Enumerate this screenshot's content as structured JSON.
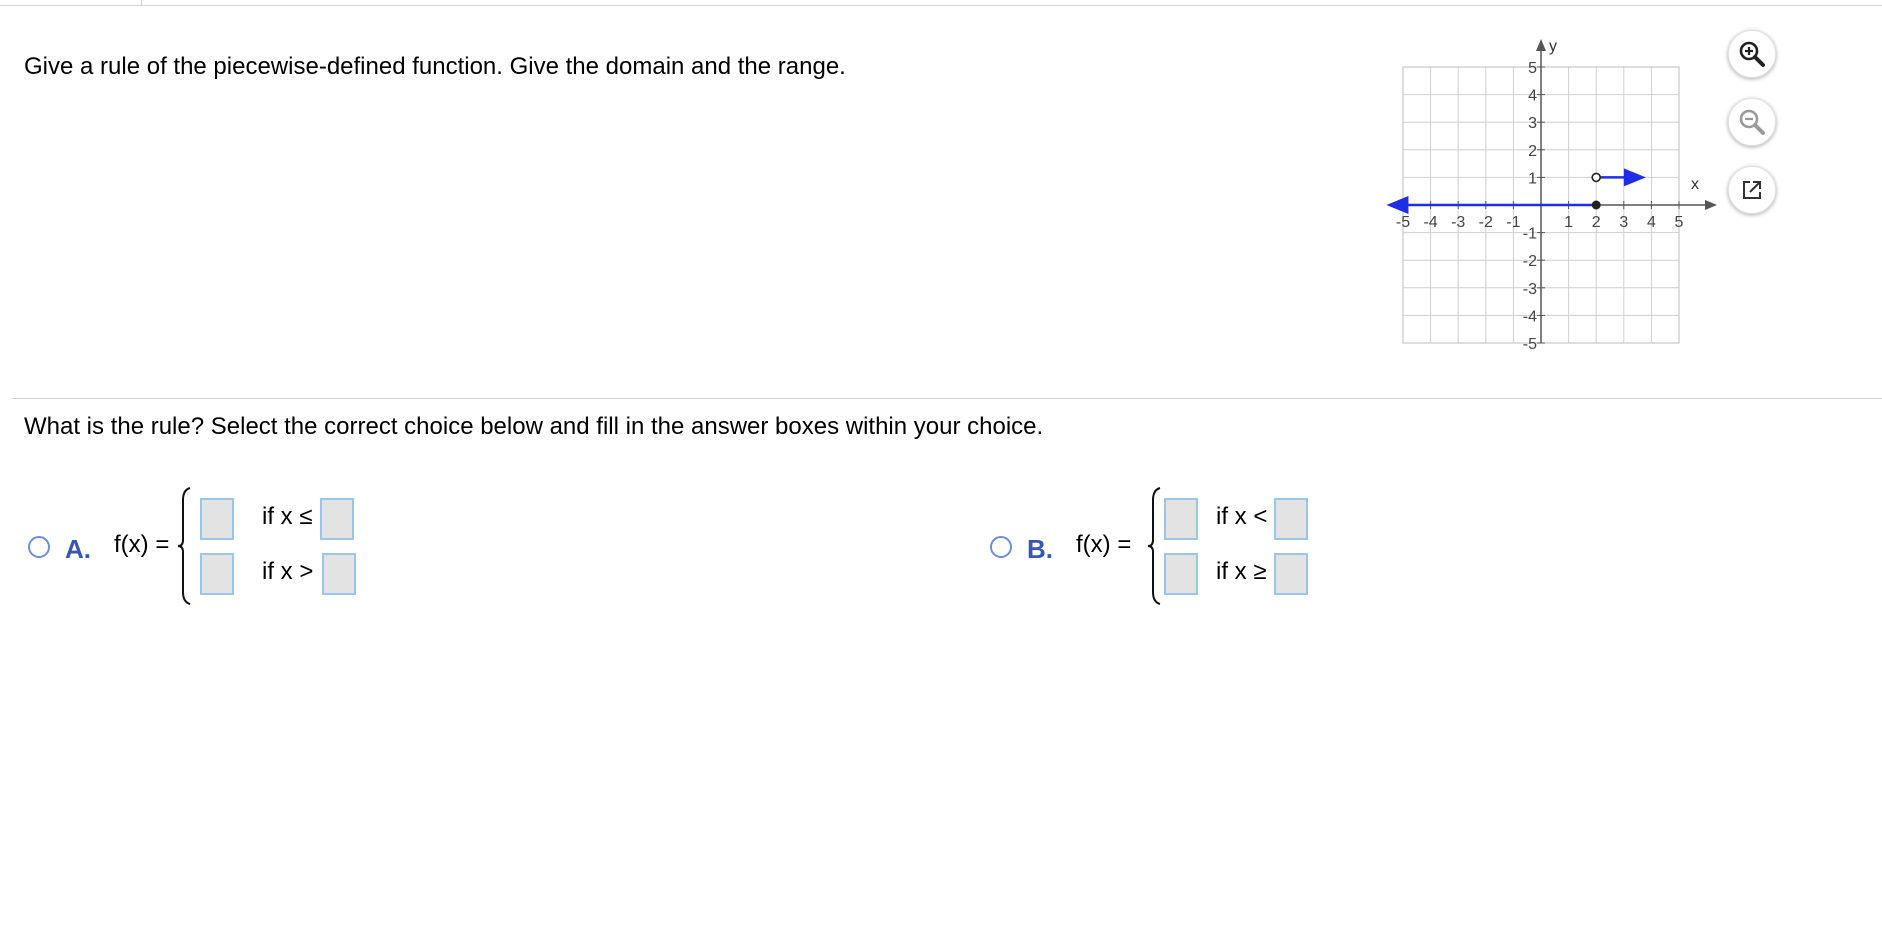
{
  "question": {
    "text": "Give a rule of the piecewise-defined function. Give the domain and the range."
  },
  "graph": {
    "x_axis_label": "x",
    "y_axis_label": "y",
    "x_ticks": [
      "-5",
      "-4",
      "-3",
      "-2",
      "-1",
      "1",
      "2",
      "3",
      "4",
      "5"
    ],
    "y_ticks": [
      "5",
      "4",
      "3",
      "2",
      "1",
      "-1",
      "-2",
      "-3",
      "-4",
      "-5"
    ],
    "curve_color": "#1f2ee6",
    "pieces": [
      {
        "from_x": -6,
        "to_x": 2,
        "y": 0,
        "left": "arrow",
        "right": "closed-dot"
      },
      {
        "from_x": 2,
        "to_x": 6,
        "y": 1,
        "left": "open-dot",
        "right": "arrow"
      }
    ],
    "tools": {
      "zoom_in": "zoom-in-icon",
      "zoom_out": "zoom-out-icon",
      "popout": "popout-icon"
    }
  },
  "prompt": {
    "text": "What is the rule? Select the correct choice below and fill in the answer boxes within your choice."
  },
  "choices": [
    {
      "letter": "A.",
      "fx": "f(x) =",
      "conditions": [
        "if x ≤",
        "if x >"
      ],
      "selected": false
    },
    {
      "letter": "B.",
      "fx": "f(x) =",
      "conditions": [
        "if x <",
        "if x ≥"
      ],
      "selected": false
    }
  ],
  "colors": {
    "choice_letter": "#3a55b4",
    "radio_border": "#6f8fd6",
    "answer_box_fill": "#e3e3e3",
    "answer_box_border": "#9cc6e6"
  }
}
